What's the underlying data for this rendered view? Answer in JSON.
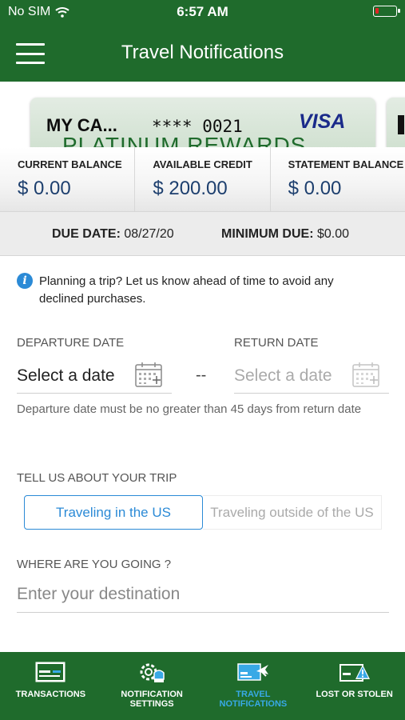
{
  "status_bar": {
    "carrier": "No SIM",
    "time": "6:57 AM"
  },
  "header": {
    "title": "Travel Notifications"
  },
  "card": {
    "name": "MY CA...",
    "number": "**** 0021",
    "network": "VISA",
    "product": "PLATINUM REWARDS"
  },
  "balances": [
    {
      "label": "CURRENT BALANCE",
      "value": "$ 0.00"
    },
    {
      "label": "AVAILABLE CREDIT",
      "value": "$ 200.00"
    },
    {
      "label": "STATEMENT BALANCE",
      "value": "$ 0.00"
    }
  ],
  "due": {
    "date_label": "DUE DATE:",
    "date_value": "08/27/20",
    "min_label": "MINIMUM DUE:",
    "min_value": "$0.00"
  },
  "info": {
    "text": "Planning a trip? Let us know ahead of time to avoid any declined purchases."
  },
  "departure": {
    "label": "DEPARTURE DATE",
    "placeholder": "Select a date"
  },
  "return_date": {
    "label": "RETURN DATE",
    "placeholder": "Select a date"
  },
  "date_separator": "--",
  "date_helper": "Departure date must be no greater than 45 days from return date",
  "trip": {
    "label": "TELL US ABOUT YOUR TRIP",
    "options": [
      "Traveling in the US",
      "Traveling outside of the US"
    ],
    "selected": "Traveling in the US"
  },
  "destination": {
    "label": "WHERE ARE YOU GOING ?",
    "placeholder": "Enter your destination"
  },
  "tabs": [
    {
      "label": "TRANSACTIONS",
      "icon": "transactions-icon"
    },
    {
      "label": "NOTIFICATION SETTINGS",
      "icon": "notification-settings-icon"
    },
    {
      "label": "TRAVEL NOTIFICATIONS",
      "icon": "travel-icon",
      "active": true
    },
    {
      "label": "LOST OR STOLEN",
      "icon": "lost-stolen-icon"
    }
  ],
  "colors": {
    "brand_green": "#1f6b2c",
    "accent_blue": "#2b8ad6",
    "active_tab": "#38a9e6",
    "battery_low": "#e02424"
  }
}
